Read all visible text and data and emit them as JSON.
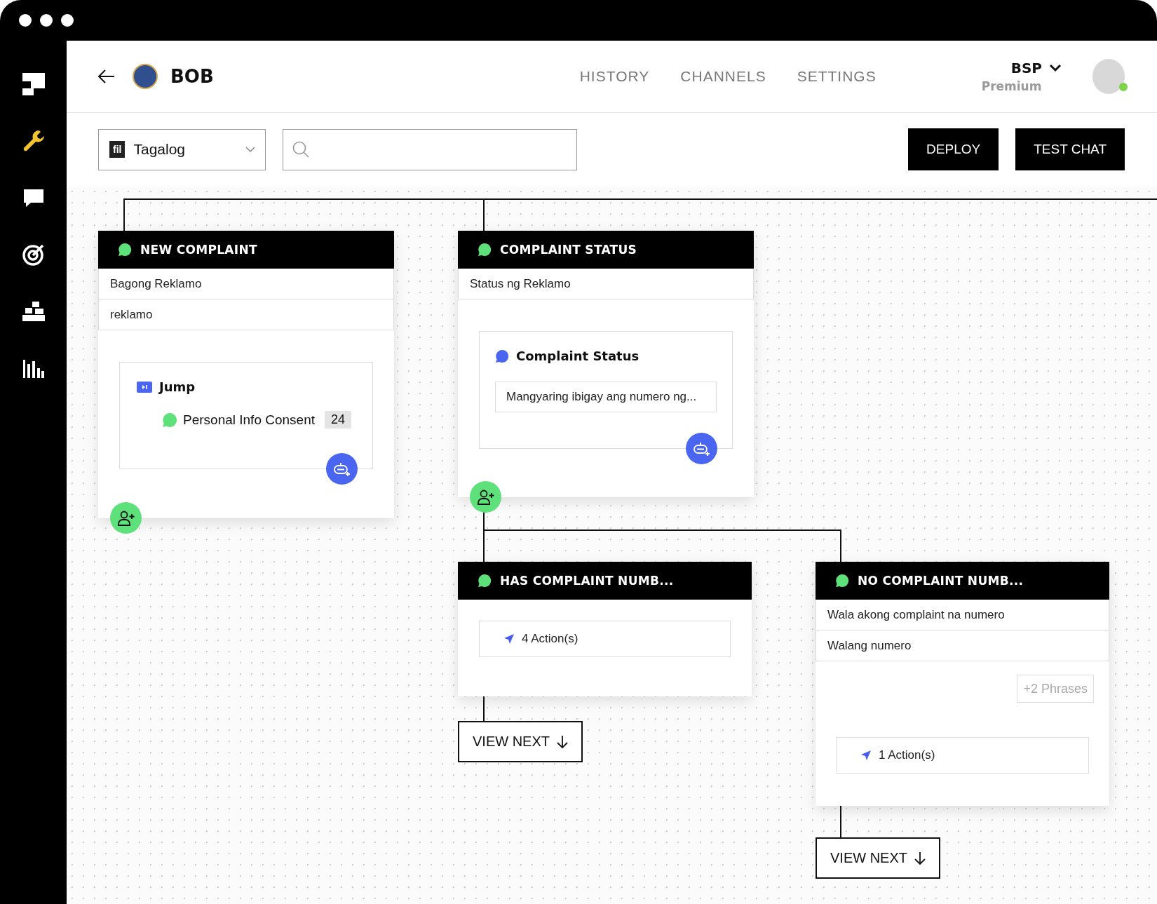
{
  "sidebar": {
    "items": [
      {
        "kind": "wrench",
        "selected": true
      },
      {
        "kind": "chat",
        "selected": false
      },
      {
        "kind": "target",
        "selected": false
      },
      {
        "kind": "blocks",
        "selected": false
      },
      {
        "kind": "chart",
        "selected": false
      }
    ]
  },
  "header": {
    "bot_name": "BOB",
    "nav": [
      {
        "label": "HISTORY",
        "selected": false
      },
      {
        "label": "CHANNELS",
        "selected": false
      },
      {
        "label": "SETTINGS",
        "selected": false
      }
    ],
    "account": {
      "name": "BSP",
      "plan": "Premium",
      "online": true
    }
  },
  "toolbar": {
    "language": {
      "code": "fil",
      "value": "Tagalog"
    },
    "buttons": [
      "DEPLOY",
      "TEST CHAT"
    ]
  },
  "nodes": [
    {
      "title": "NEW COMPLAINT",
      "phrases": [
        "Bagong Reklamo",
        "reklamo"
      ],
      "block": {
        "kind": "jump",
        "title": "Jump",
        "target": "Personal Info Consent",
        "count": "24"
      },
      "add_response": true,
      "add_user": true
    },
    {
      "title": "COMPLAINT STATUS",
      "phrases": [
        "Status ng Reklamo"
      ],
      "block": {
        "kind": "message",
        "title": "Complaint Status",
        "text": "Mangyaring ibigay ang numero ng..."
      },
      "add_response": true,
      "add_user": true
    },
    {
      "title": "HAS COMPLAINT NUMB...",
      "block": {
        "kind": "actions",
        "text": "4 Action(s)"
      },
      "view_next": "VIEW NEXT"
    },
    {
      "title": "NO COMPLAINT NUMB...",
      "phrases": [
        "Wala akong complaint na numero",
        "Walang numero"
      ],
      "more_phrases": "+2 Phrases",
      "block": {
        "kind": "actions",
        "text": "1 Action(s)"
      },
      "view_next": "VIEW NEXT"
    }
  ]
}
